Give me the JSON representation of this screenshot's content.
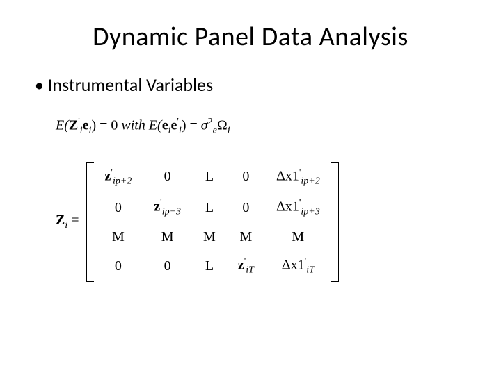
{
  "title": "Dynamic Panel Data Analysis",
  "bullet": "Instrumental Variables",
  "eq": {
    "e_pre": "E(",
    "z_sym": "Z",
    "e_sym": "e",
    "close_zero": ") = 0",
    "with": " with ",
    "close": ") = ",
    "sigma": "σ",
    "two": "2",
    "omega": "Ω",
    "sub_i": "i",
    "sub_e": "e",
    "prime": "'"
  },
  "matrix": {
    "lhs": "Z",
    "lhs_sub": "i",
    "eq": " =",
    "z": "z",
    "dx": "Δx1",
    "sub_ip2": "ip+2",
    "sub_ip3": "ip+3",
    "sub_iT": "iT",
    "zero": "0",
    "L": "L",
    "M": "M",
    "prime": "'"
  }
}
